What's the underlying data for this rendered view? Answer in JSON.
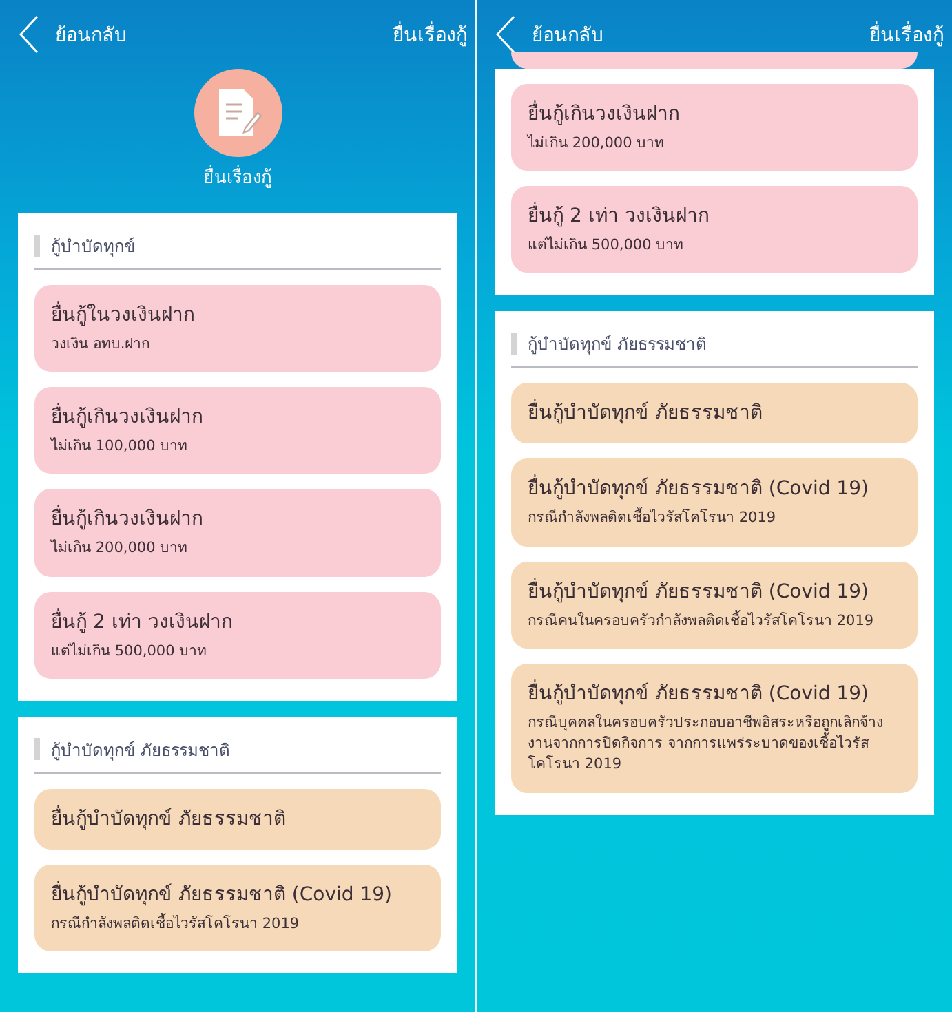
{
  "screens": [
    {
      "nav": {
        "back": "ย้อนกลับ",
        "title": "ยื่นเรื่องกู้"
      },
      "header": {
        "title": "ยื่นเรื่องกู้"
      },
      "sections": [
        {
          "title": "กู้บำบัดทุกข์",
          "color": "#f9cdd3",
          "items": [
            {
              "kind": "loan",
              "title": "ยื่นกู้ในวงเงินฝาก",
              "subtitle": "วงเงิน อทบ.ฝาก"
            },
            {
              "kind": "loan",
              "title": "ยื่นกู้เกินวงเงินฝาก",
              "subtitle": "ไม่เกิน 100,000 บาท"
            },
            {
              "kind": "loan",
              "title": "ยื่นกู้เกินวงเงินฝาก",
              "subtitle": "ไม่เกิน 200,000 บาท"
            },
            {
              "kind": "loan",
              "title": "ยื่นกู้ 2 เท่า วงเงินฝาก",
              "subtitle": "แต่ไม่เกิน 500,000 บาท"
            }
          ]
        },
        {
          "title": "กู้บำบัดทุกข์ ภัยธรรมชาติ",
          "color": "#f5d9b8",
          "items": [
            {
              "kind": "loan",
              "title": "ยื่นกู้บำบัดทุกข์ ภัยธรรมชาติ"
            },
            {
              "kind": "loan",
              "title": "ยื่นกู้บำบัดทุกข์ ภัยธรรมชาติ (Covid 19)",
              "subtitle": "กรณีกำลังพลติดเชื้อไวรัสโคโรนา 2019"
            }
          ]
        }
      ]
    },
    {
      "nav": {
        "back": "ย้อนกลับ",
        "title": "ยื่นเรื่องกู้"
      },
      "sections": [
        {
          "color": "#f9cdd3",
          "items": [
            {
              "kind": "cut"
            },
            {
              "kind": "loan",
              "title": "ยื่นกู้เกินวงเงินฝาก",
              "subtitle": "ไม่เกิน 200,000 บาท"
            },
            {
              "kind": "loan",
              "title": "ยื่นกู้ 2 เท่า วงเงินฝาก",
              "subtitle": "แต่ไม่เกิน 500,000 บาท"
            }
          ]
        },
        {
          "title": "กู้บำบัดทุกข์ ภัยธรรมชาติ",
          "color": "#f5d9b8",
          "items": [
            {
              "kind": "loan",
              "title": "ยื่นกู้บำบัดทุกข์ ภัยธรรมชาติ"
            },
            {
              "kind": "loan",
              "title": "ยื่นกู้บำบัดทุกข์ ภัยธรรมชาติ (Covid 19)",
              "subtitle": "กรณีกำลังพลติดเชื้อไวรัสโคโรนา 2019"
            },
            {
              "kind": "loan",
              "title": "ยื่นกู้บำบัดทุกข์ ภัยธรรมชาติ (Covid 19)",
              "subtitle": "กรณีคนในครอบครัวกำลังพลติดเชื้อไวรัสโคโรนา 2019"
            },
            {
              "kind": "loan",
              "title": "ยื่นกู้บำบัดทุกข์ ภัยธรรมชาติ (Covid 19)",
              "subtitle": "กรณีบุคคลในครอบครัวประกอบอาชีพอิสระหรือถูกเลิกจ้างงานจากการปิดกิจการ จากการแพร่ระบาดของเชื้อไวรัสโคโรนา 2019"
            }
          ]
        }
      ]
    }
  ]
}
